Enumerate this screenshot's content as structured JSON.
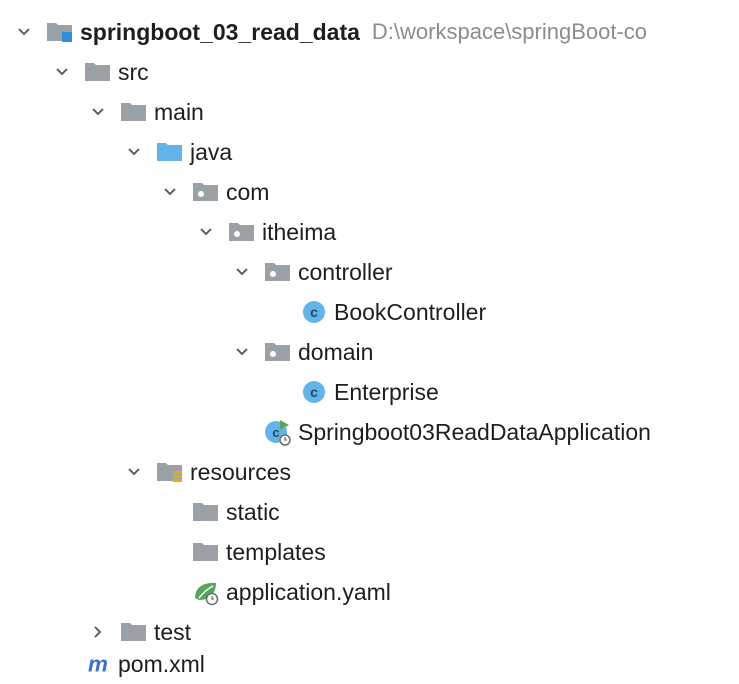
{
  "project": {
    "name": "springboot_03_read_data",
    "path": "D:\\workspace\\springBoot-co"
  },
  "tree": {
    "src": "src",
    "main": "main",
    "java": "java",
    "com": "com",
    "itheima": "itheima",
    "controller": "controller",
    "book_controller": "BookController",
    "domain": "domain",
    "enterprise": "Enterprise",
    "application_class": "Springboot03ReadDataApplication",
    "resources": "resources",
    "static": "static",
    "templates": "templates",
    "application_yaml": "application.yaml",
    "test": "test",
    "pom": "pom.xml"
  },
  "icons": {
    "chevron_down": "chevron-down-icon",
    "chevron_right": "chevron-right-icon",
    "module_folder": "module-folder-icon",
    "folder": "folder-icon",
    "source_folder": "source-root-folder-icon",
    "package": "package-icon",
    "class": "java-class-icon",
    "spring_boot_class": "spring-boot-class-icon",
    "resources_folder": "resources-folder-icon",
    "yaml": "spring-yaml-icon",
    "maven": "maven-icon"
  },
  "colors": {
    "folder_gray": "#9aa0a6",
    "source_blue": "#62b4e8",
    "class_circle": "#62b4e8",
    "spring_green": "#58a55c",
    "maven_blue": "#3a6fd8",
    "path_gray": "#8c8c8c"
  }
}
